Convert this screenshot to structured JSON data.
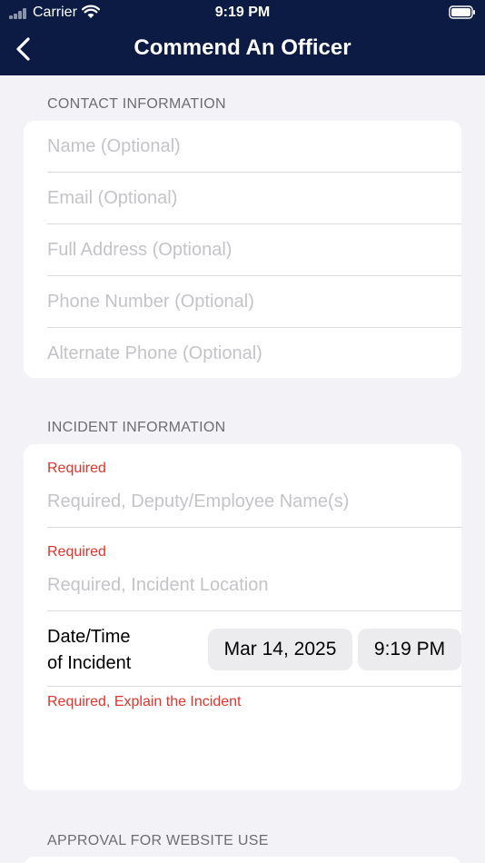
{
  "status_bar": {
    "carrier": "Carrier",
    "time": "9:19 PM"
  },
  "navbar": {
    "title": "Commend An Officer",
    "back_icon": "chevron-left-icon",
    "background": "#0b1b44"
  },
  "contact_section": {
    "header": "CONTACT INFORMATION",
    "fields": [
      {
        "placeholder": "Name (Optional)",
        "value": ""
      },
      {
        "placeholder": "Email (Optional)",
        "value": ""
      },
      {
        "placeholder": "Full Address (Optional)",
        "value": ""
      },
      {
        "placeholder": "Phone Number (Optional)",
        "value": ""
      },
      {
        "placeholder": "Alternate Phone (Optional)",
        "value": ""
      }
    ]
  },
  "incident_section": {
    "header": "INCIDENT INFORMATION",
    "employee": {
      "required_label": "Required",
      "placeholder": "Required, Deputy/Employee Name(s)",
      "value": ""
    },
    "location": {
      "required_label": "Required",
      "placeholder": "Required, Incident Location",
      "value": ""
    },
    "datetime": {
      "label_line1": "Date/Time",
      "label_line2": "of Incident",
      "date": "Mar 14, 2025",
      "time": "9:19 PM"
    },
    "explain": {
      "label": "Required, Explain the Incident",
      "value": ""
    },
    "required_color": "#e0342c"
  },
  "approval_section": {
    "header": "APPROVAL FOR WEBSITE USE"
  }
}
